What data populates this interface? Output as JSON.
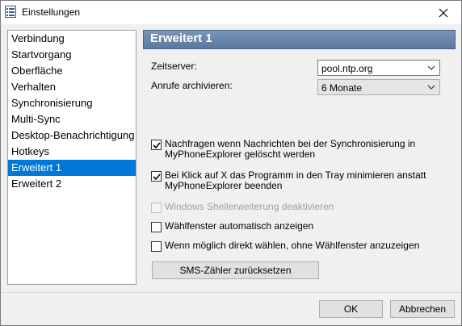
{
  "window": {
    "title": "Einstellungen"
  },
  "sidebar": {
    "items": [
      {
        "label": "Verbindung",
        "selected": false
      },
      {
        "label": "Startvorgang",
        "selected": false
      },
      {
        "label": "Oberfläche",
        "selected": false
      },
      {
        "label": "Verhalten",
        "selected": false
      },
      {
        "label": "Synchronisierung",
        "selected": false
      },
      {
        "label": "Multi-Sync",
        "selected": false
      },
      {
        "label": "Desktop-Benachrichtigung",
        "selected": false
      },
      {
        "label": "Hotkeys",
        "selected": false
      },
      {
        "label": "Erweitert 1",
        "selected": true
      },
      {
        "label": "Erweitert 2",
        "selected": false
      }
    ]
  },
  "panel": {
    "title": "Erweitert 1",
    "zeitserver": {
      "label": "Zeitserver:",
      "value": "pool.ntp.org"
    },
    "archivieren": {
      "label": "Anrufe archivieren:",
      "value": "6 Monate"
    },
    "checks": [
      {
        "label": "Nachfragen wenn Nachrichten bei der Synchronisierung in MyPhoneExplorer gelöscht werden",
        "checked": true,
        "enabled": true
      },
      {
        "label": "Bei Klick auf X das Programm in den Tray minimieren anstatt MyPhoneExplorer beenden",
        "checked": true,
        "enabled": true
      },
      {
        "label": "Windows Shellerweiterung deaktivieren",
        "checked": false,
        "enabled": false
      },
      {
        "label": "Wählfenster automatisch anzeigen",
        "checked": false,
        "enabled": true
      },
      {
        "label": "Wenn möglich direkt wählen, ohne Wählfenster anzuzeigen",
        "checked": false,
        "enabled": true
      }
    ],
    "reset_button": "SMS-Zähler zurücksetzen"
  },
  "footer": {
    "ok": "OK",
    "cancel": "Abbrechen"
  },
  "colors": {
    "selection": "#0078d7",
    "header": "#6a86ac",
    "accent_check": "#000000"
  },
  "icons": {
    "app": "settings-list-icon",
    "close": "close-icon",
    "dropdown": "chevron-down-icon",
    "check": "checkmark-icon"
  }
}
